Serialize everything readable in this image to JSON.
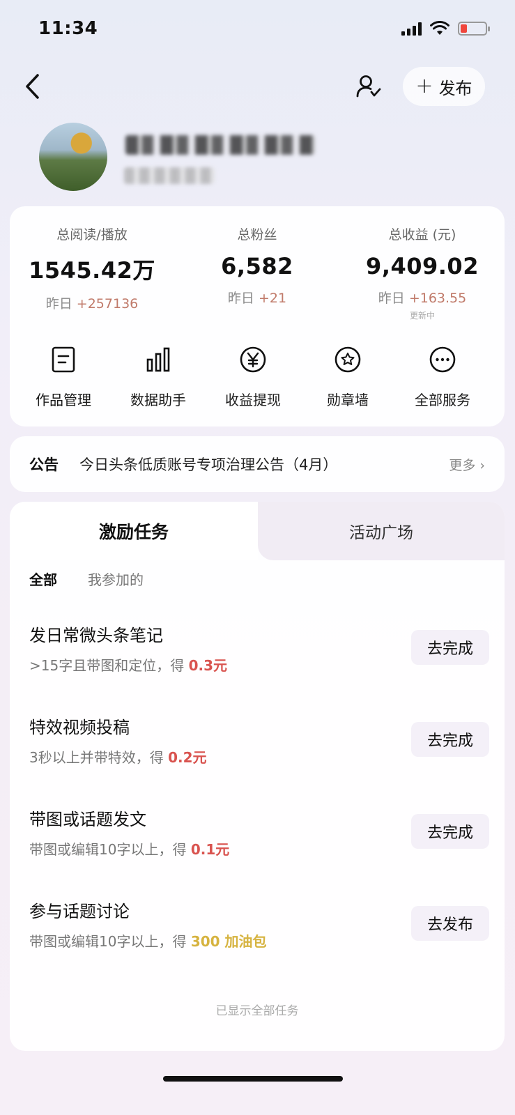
{
  "status_bar": {
    "time": "11:34"
  },
  "header": {
    "publish_label": "发布"
  },
  "stats": [
    {
      "label": "总阅读/播放",
      "value": "1545.42万",
      "delta_prefix": "昨日 ",
      "delta": "+257136",
      "note": ""
    },
    {
      "label": "总粉丝",
      "value": "6,582",
      "delta_prefix": "昨日 ",
      "delta": "+21",
      "note": ""
    },
    {
      "label": "总收益 (元)",
      "value": "9,409.02",
      "delta_prefix": "昨日 ",
      "delta": "+163.55",
      "note": "更新中"
    }
  ],
  "services": [
    {
      "label": "作品管理",
      "icon": "document-icon"
    },
    {
      "label": "数据助手",
      "icon": "bar-chart-icon"
    },
    {
      "label": "收益提现",
      "icon": "yuan-icon"
    },
    {
      "label": "勋章墙",
      "icon": "badge-icon"
    },
    {
      "label": "全部服务",
      "icon": "more-icon"
    }
  ],
  "notice": {
    "title": "公告",
    "text": "今日头条低质账号专项治理公告（4月）",
    "more": "更多 ›"
  },
  "tabs": {
    "active": "激励任务",
    "inactive": "活动广场"
  },
  "filters": {
    "all": "全部",
    "mine": "我参加的"
  },
  "tasks": [
    {
      "title": "发日常微头条笔记",
      "desc_prefix": ">15字且带图和定位，得 ",
      "reward": "0.3元",
      "button": "去完成"
    },
    {
      "title": "特效视频投稿",
      "desc_prefix": "3秒以上并带特效，得 ",
      "reward": "0.2元",
      "button": "去完成"
    },
    {
      "title": "带图或话题发文",
      "desc_prefix": "带图或编辑10字以上，得 ",
      "reward": "0.1元",
      "button": "去完成"
    },
    {
      "title": "参与话题讨论",
      "desc_prefix": "带图或编辑10字以上，得 ",
      "reward": "300 加油包",
      "button": "去发布"
    }
  ],
  "footer": {
    "all_shown": "已显示全部任务"
  },
  "colors": {
    "reward_red": "#d9534f",
    "reward_yellow": "#d6b340",
    "delta": "#c07a6a"
  }
}
